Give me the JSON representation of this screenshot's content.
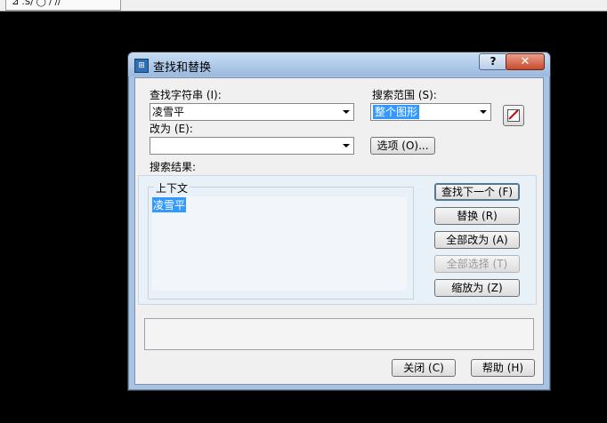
{
  "host": {
    "toolbar_glyphs": "⊿ .S/ ◯ ∕ /∕"
  },
  "dialog": {
    "title": "查找和替换",
    "help_glyph": "?",
    "close_glyph": "✕",
    "find_label": "查找字符串 (I):",
    "find_value": "凌雪平",
    "replace_label": "改为 (E):",
    "replace_value": "",
    "scope_label": "搜索范围 (S):",
    "scope_value": "整个图形",
    "options_button": "选项 (O)...",
    "results_label": "搜索结果:",
    "context_group": "上下文",
    "result_item": "凌雪平",
    "buttons": {
      "find_next": "查找下一个 (F)",
      "replace": "替换 (R)",
      "replace_all": "全部改为 (A)",
      "select_all": "全部选择 (T)",
      "zoom_to": "缩放为 (Z)",
      "close": "关闭 (C)",
      "help": "帮助 (H)"
    }
  }
}
